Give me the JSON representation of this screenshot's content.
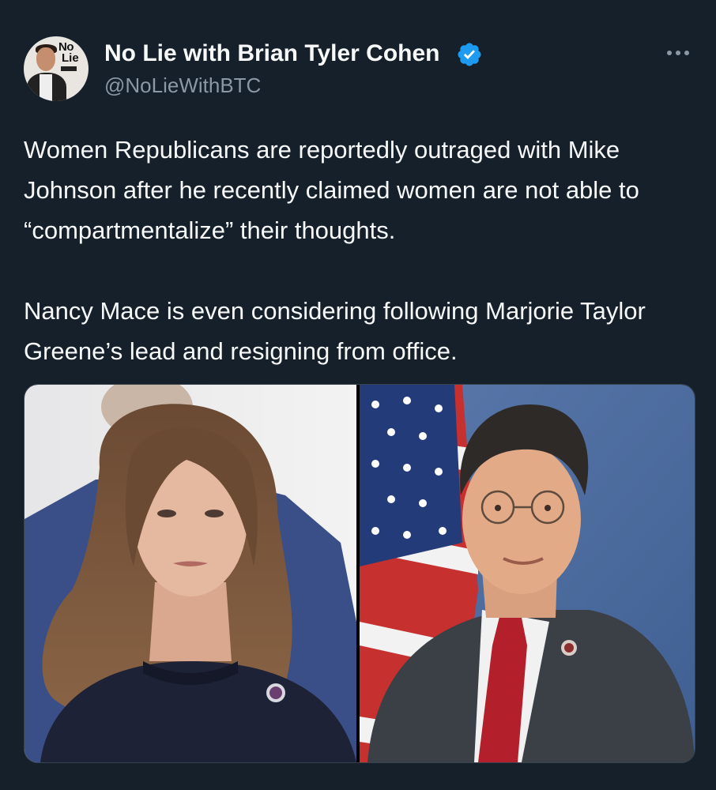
{
  "author": {
    "display_name": "No Lie with Brian Tyler Cohen",
    "handle": "@NoLieWithBTC",
    "verified": true,
    "avatar_logo_line1": "No",
    "avatar_logo_line2": "Lie"
  },
  "tweet": {
    "paragraphs": [
      "Women Republicans are reportedly outraged with Mike Johnson after he recently claimed women are not able to “compartmentalize” their thoughts.",
      "Nancy Mace is even considering following Marjorie Taylor Greene’s lead and resigning from office."
    ]
  },
  "media": {
    "images": [
      {
        "subject": "woman-portrait-photo"
      },
      {
        "subject": "man-portrait-with-flag-photo"
      }
    ]
  },
  "icons": {
    "verified": "verified-badge-icon",
    "more": "more-options-icon"
  },
  "colors": {
    "background": "#15202b",
    "text": "#f7f9f9",
    "muted": "#8b98a5",
    "verified": "#1d9bf0"
  }
}
